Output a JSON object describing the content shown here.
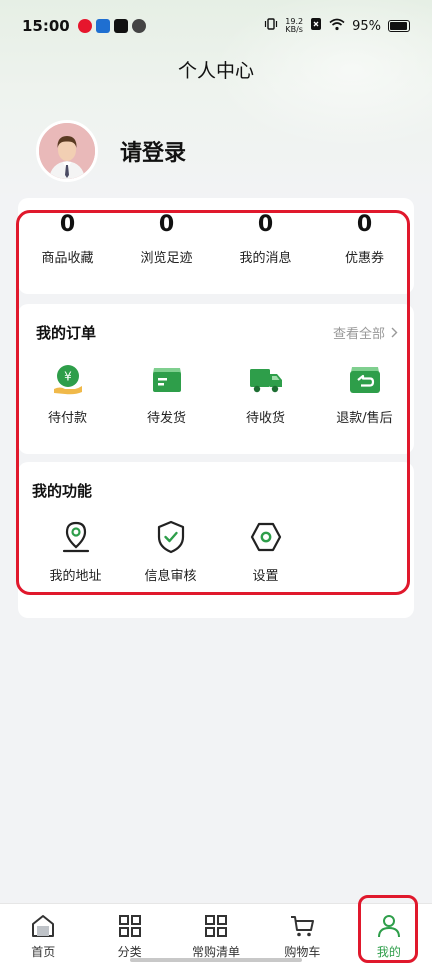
{
  "status_bar": {
    "time": "15:00",
    "net_speed_value": "19.2",
    "net_speed_unit": "KB/s",
    "battery": "95%"
  },
  "page": {
    "title": "个人中心"
  },
  "profile": {
    "login_text": "请登录"
  },
  "stats": [
    {
      "value": "0",
      "label": "商品收藏"
    },
    {
      "value": "0",
      "label": "浏览足迹"
    },
    {
      "value": "0",
      "label": "我的消息"
    },
    {
      "value": "0",
      "label": "优惠券"
    }
  ],
  "orders": {
    "title": "我的订单",
    "view_all": "查看全部",
    "items": [
      {
        "label": "待付款",
        "icon": "pending-payment-icon"
      },
      {
        "label": "待发货",
        "icon": "pending-shipment-icon"
      },
      {
        "label": "待收货",
        "icon": "pending-receipt-icon"
      },
      {
        "label": "退款/售后",
        "icon": "refund-icon"
      }
    ]
  },
  "functions": {
    "title": "我的功能",
    "items": [
      {
        "label": "我的地址",
        "icon": "location-icon"
      },
      {
        "label": "信息审核",
        "icon": "shield-check-icon"
      },
      {
        "label": "设置",
        "icon": "settings-icon"
      }
    ]
  },
  "bottom_nav": {
    "active_index": 4,
    "items": [
      {
        "label": "首页",
        "icon": "home-icon"
      },
      {
        "label": "分类",
        "icon": "category-icon"
      },
      {
        "label": "常购清单",
        "icon": "list-icon"
      },
      {
        "label": "购物车",
        "icon": "cart-icon"
      },
      {
        "label": "我的",
        "icon": "profile-icon"
      }
    ]
  },
  "colors": {
    "accent_green": "#2e9e4a",
    "highlight_red": "#e0182c"
  }
}
